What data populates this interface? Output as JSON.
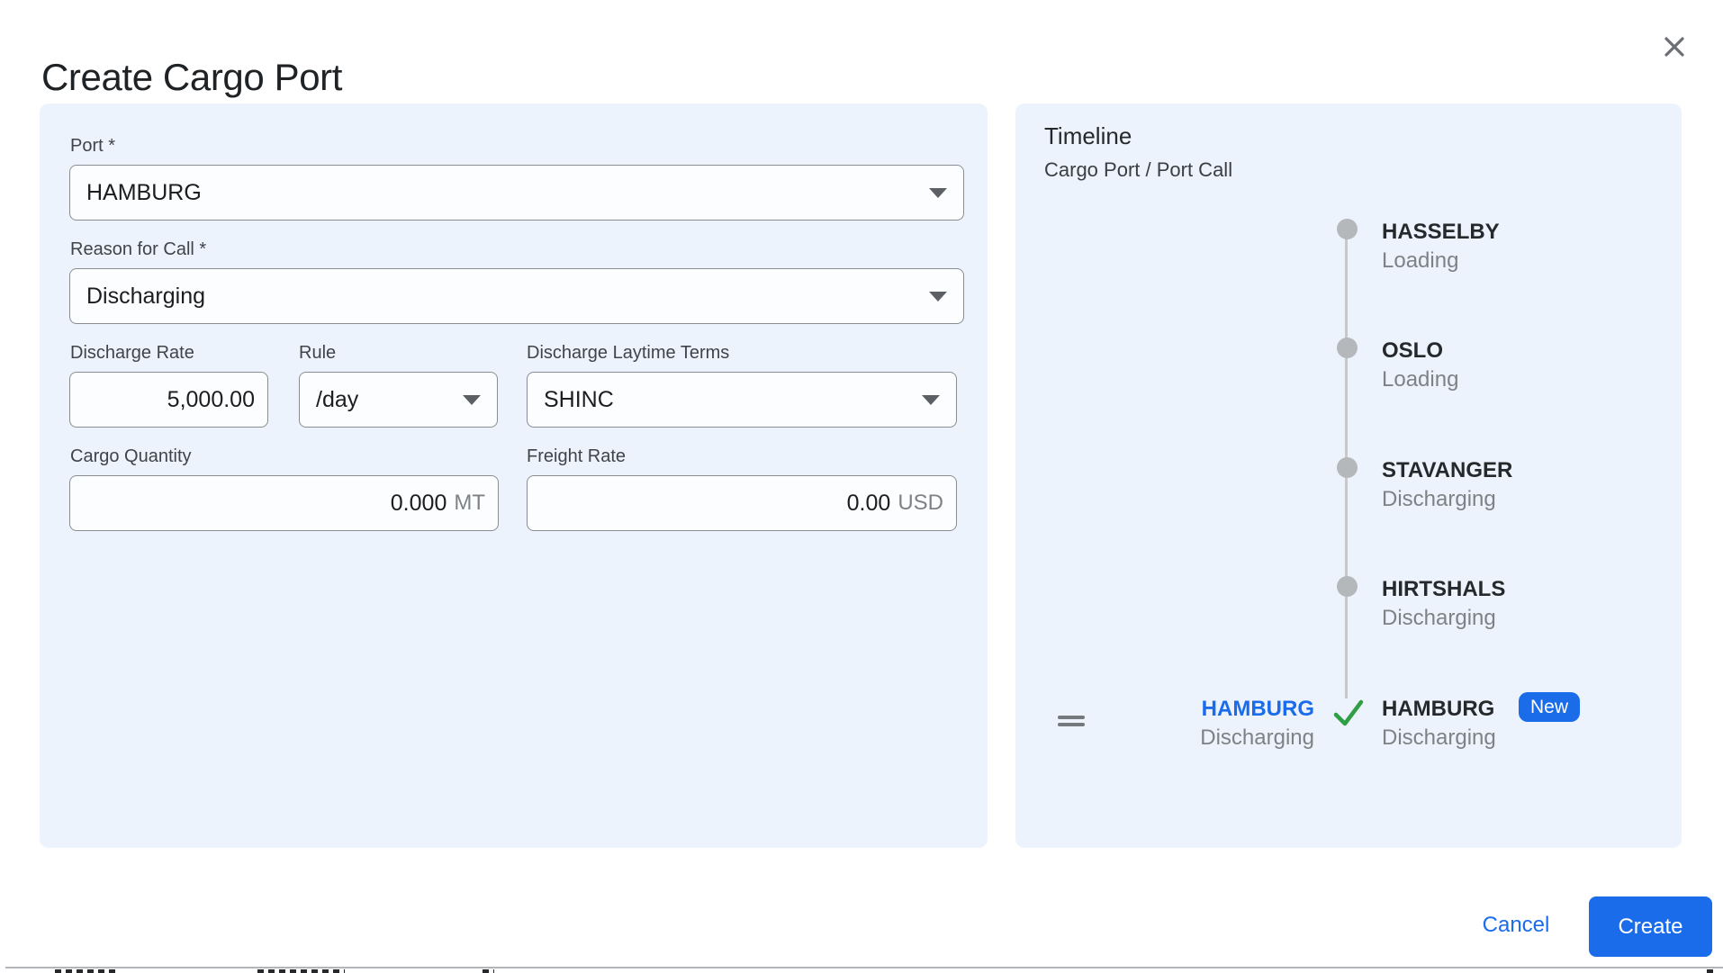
{
  "colors": {
    "accent_blue": "#1a6ceb",
    "success_green": "#2f9e44",
    "panel_background": "#edf3fc"
  },
  "dialog": {
    "title": "Create Cargo Port"
  },
  "form": {
    "port": {
      "label": "Port *",
      "value": "HAMBURG"
    },
    "reason_for_call": {
      "label": "Reason for Call *",
      "value": "Discharging"
    },
    "discharge_rate": {
      "label": "Discharge Rate",
      "value": "5,000.00"
    },
    "rule": {
      "label": "Rule",
      "value": "/day"
    },
    "discharge_laytime_terms": {
      "label": "Discharge Laytime Terms",
      "value": "SHINC"
    },
    "cargo_quantity": {
      "label": "Cargo Quantity",
      "value": "0.000",
      "unit": "MT"
    },
    "freight_rate": {
      "label": "Freight Rate",
      "value": "0.00",
      "unit": "USD"
    }
  },
  "timeline": {
    "title": "Timeline",
    "subtitle": "Cargo Port / Port Call",
    "items": [
      {
        "port": "HASSELBY",
        "status": "Loading"
      },
      {
        "port": "OSLO",
        "status": "Loading"
      },
      {
        "port": "STAVANGER",
        "status": "Discharging"
      },
      {
        "port": "HIRTSHALS",
        "status": "Discharging"
      }
    ],
    "new_entry": {
      "cargo_port": "HAMBURG",
      "cargo_port_status": "Discharging",
      "port_call": "HAMBURG",
      "port_call_status": "Discharging",
      "badge": "New"
    }
  },
  "footer": {
    "cancel_label": "Cancel",
    "create_label": "Create"
  }
}
